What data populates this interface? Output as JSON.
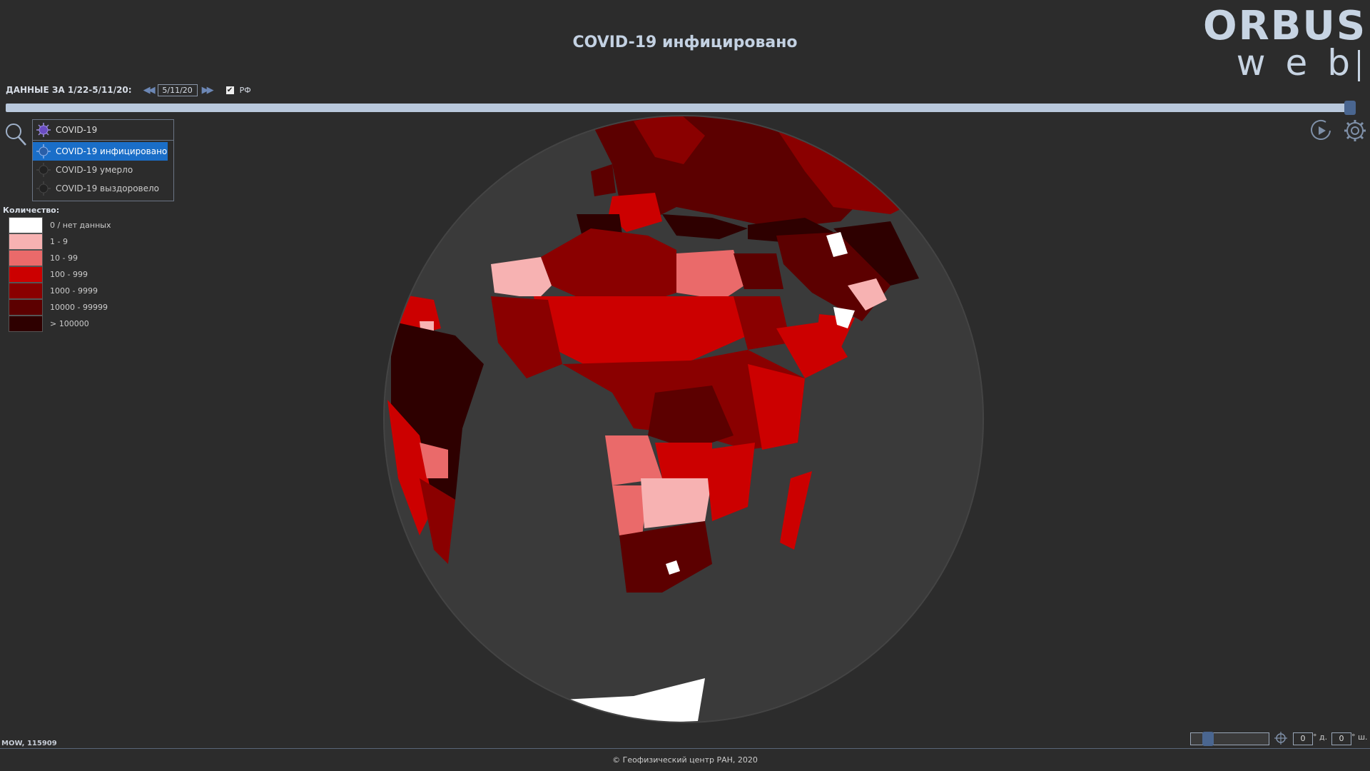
{
  "title": "COVID-19 инфицировано",
  "logo": {
    "line1": "ORBUS",
    "line2": "web"
  },
  "data_controls": {
    "label": "ДАННЫЕ ЗА 1/22-5/11/20:",
    "date_value": "5/11/20",
    "rf_checked": true,
    "rf_label": "РФ"
  },
  "timeline": {
    "progress": 1.0
  },
  "layer_select": {
    "value": "COVID-19",
    "options": [
      {
        "label": "COVID-19 инфицировано",
        "selected": true
      },
      {
        "label": "COVID-19 умерло",
        "selected": false
      },
      {
        "label": "COVID-19 выздоровело",
        "selected": false
      }
    ]
  },
  "legend": {
    "title": "Количество:",
    "items": [
      {
        "label": "0 / нет данных",
        "color": "#ffffff"
      },
      {
        "label": "1 - 9",
        "color": "#f7b2b2"
      },
      {
        "label": "10 - 99",
        "color": "#ea6a6a"
      },
      {
        "label": "100 - 999",
        "color": "#cc0000"
      },
      {
        "label": "1000 - 9999",
        "color": "#8a0000"
      },
      {
        "label": "10000 - 99999",
        "color": "#5c0000"
      },
      {
        "label": "> 100000",
        "color": "#2e0000"
      }
    ]
  },
  "status": {
    "coords": "MOW, 115909"
  },
  "footer": {
    "copyright": "© Геофизический центр РАН, 2020"
  },
  "navigation": {
    "zoom_level": 0.15,
    "lon_value": "0",
    "lon_unit": "° д.",
    "lat_value": "0",
    "lat_unit": "° ш."
  },
  "colors": {
    "accent": "#4a6690",
    "selected": "#1a6ec8",
    "background": "#2c2c2c"
  }
}
